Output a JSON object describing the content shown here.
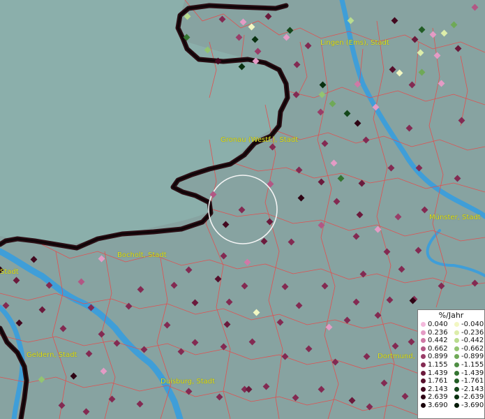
{
  "legend": {
    "title": "%/Jahr",
    "positive": [
      {
        "value": "0.040",
        "color": "#f3b9dc"
      },
      {
        "value": "0.236",
        "color": "#e49bc5"
      },
      {
        "value": "0.442",
        "color": "#cf79a6"
      },
      {
        "value": "0.662",
        "color": "#b25784"
      },
      {
        "value": "0.899",
        "color": "#993d68"
      },
      {
        "value": "1.155",
        "color": "#832a52"
      },
      {
        "value": "1.439",
        "color": "#6b1a3c"
      },
      {
        "value": "1.761",
        "color": "#560f2c"
      },
      {
        "value": "2.143",
        "color": "#42081f"
      },
      {
        "value": "2.639",
        "color": "#2e0414"
      },
      {
        "value": "3.690",
        "color": "#18020a"
      }
    ],
    "negative": [
      {
        "value": "-0.040",
        "color": "#f2f7c2"
      },
      {
        "value": "-0.236",
        "color": "#dcedaa"
      },
      {
        "value": "-0.442",
        "color": "#b9dc8e"
      },
      {
        "value": "-0.662",
        "color": "#93c471"
      },
      {
        "value": "-0.899",
        "color": "#6fa957"
      },
      {
        "value": "-1.155",
        "color": "#4f8e44"
      },
      {
        "value": "-1.439",
        "color": "#357532"
      },
      {
        "value": "-1.761",
        "color": "#225d25"
      },
      {
        "value": "-2.143",
        "color": "#14461a"
      },
      {
        "value": "-2.639",
        "color": "#093110"
      },
      {
        "value": "-3.690",
        "color": "#031a06"
      }
    ]
  },
  "cities": [
    {
      "id": "lingen",
      "label": "Lingen (Ems), Stadt"
    },
    {
      "id": "gronau",
      "label": "Gronau (Westf.), Stadt"
    },
    {
      "id": "muenster",
      "label": "Münster, Stadt"
    },
    {
      "id": "bocholt",
      "label": "Bocholt, Stadt"
    },
    {
      "id": "stadt-west",
      "label": "Stadt"
    },
    {
      "id": "geldern",
      "label": "Geldern, Stadt"
    },
    {
      "id": "duisburg",
      "label": "Duisburg, Stadt"
    },
    {
      "id": "dortmund",
      "label": "Dortmund, S"
    }
  ],
  "colors": {
    "background": "#8aa5a3",
    "border": "#e05050",
    "river": "#3f9ed8",
    "national_border": "#1a0a0e",
    "label": "#e5e51a",
    "highlight_ring": "#f5f5f5"
  }
}
